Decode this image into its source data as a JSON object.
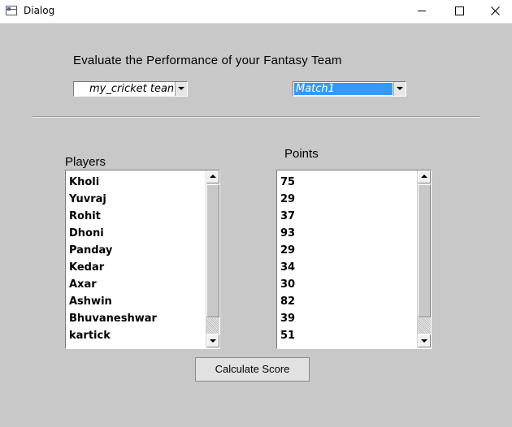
{
  "window": {
    "title": "Dialog"
  },
  "main": {
    "heading": "Evaluate the Performance of your Fantasy Team",
    "team_select": {
      "selected": "my_cricket tean"
    },
    "match_select": {
      "selected": "Match1"
    },
    "players_label": "Players",
    "points_label": "Points",
    "players": [
      "Kholi",
      "Yuvraj",
      "Rohit",
      "Dhoni",
      "Panday",
      "Kedar",
      "Axar",
      "Ashwin",
      "Bhuvaneshwar",
      "kartick"
    ],
    "points": [
      "75",
      "29",
      "37",
      "93",
      "29",
      "34",
      "30",
      "82",
      "39",
      "51"
    ],
    "calculate_button": "Calculate Score"
  },
  "icons": {
    "app": "app-window-icon",
    "minimize": "minimize-icon",
    "maximize": "maximize-icon",
    "close": "close-icon"
  },
  "colors": {
    "window_bg": "#c8c8c8",
    "selection": "#3399ff"
  }
}
